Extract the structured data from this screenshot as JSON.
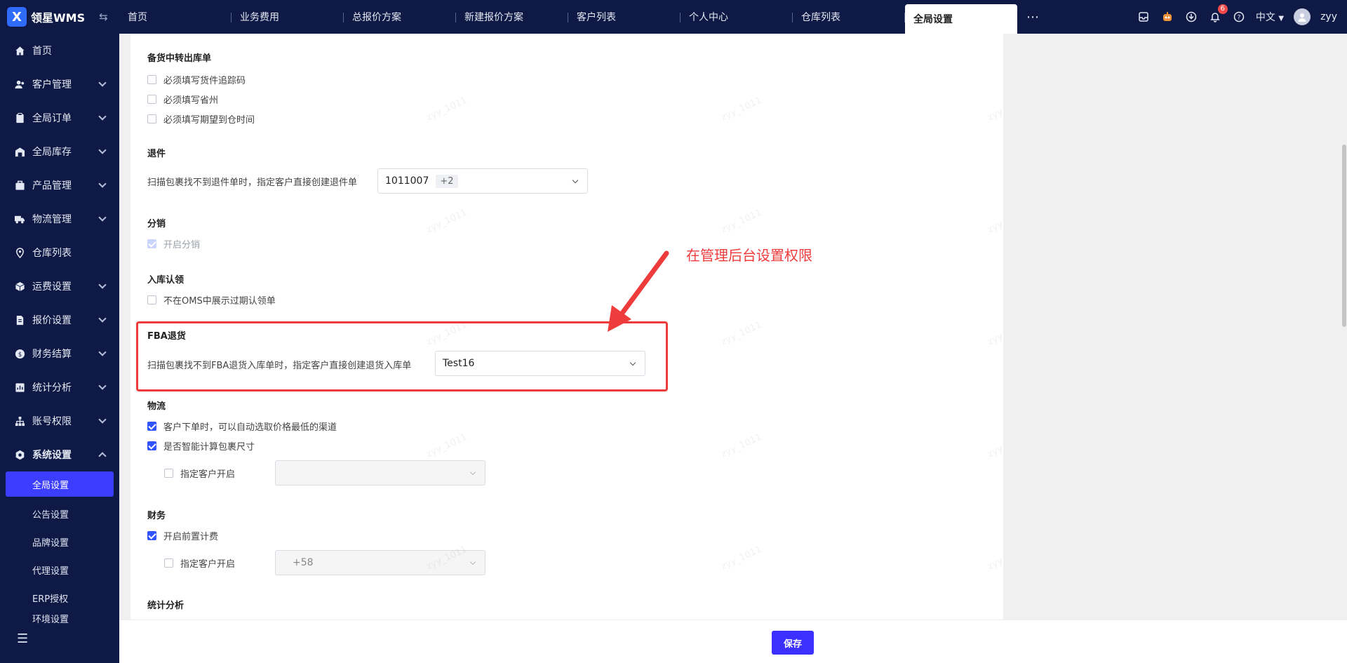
{
  "app": {
    "logo_letter": "X",
    "name": "领星WMS"
  },
  "tabs": [
    {
      "label": "首页"
    },
    {
      "label": "业务费用"
    },
    {
      "label": "总报价方案"
    },
    {
      "label": "新建报价方案"
    },
    {
      "label": "客户列表"
    },
    {
      "label": "个人中心"
    },
    {
      "label": "仓库列表"
    },
    {
      "label": "全局设置",
      "active": true
    }
  ],
  "header": {
    "notification_count": "6",
    "language": "中文",
    "username": "zyy"
  },
  "sidebar": {
    "items": [
      {
        "label": "首页",
        "icon": "home-icon"
      },
      {
        "label": "客户管理",
        "icon": "users-icon"
      },
      {
        "label": "全局订单",
        "icon": "clipboard-icon"
      },
      {
        "label": "全局库存",
        "icon": "warehouse-icon"
      },
      {
        "label": "产品管理",
        "icon": "box-icon"
      },
      {
        "label": "物流管理",
        "icon": "truck-icon"
      },
      {
        "label": "仓库列表",
        "icon": "location-icon"
      },
      {
        "label": "运费设置",
        "icon": "cube-icon"
      },
      {
        "label": "报价设置",
        "icon": "document-icon"
      },
      {
        "label": "财务结算",
        "icon": "coin-icon"
      },
      {
        "label": "统计分析",
        "icon": "chart-icon"
      },
      {
        "label": "账号权限",
        "icon": "org-icon"
      },
      {
        "label": "系统设置",
        "icon": "settings-icon"
      }
    ],
    "sub_items": [
      {
        "label": "全局设置"
      },
      {
        "label": "公告设置"
      },
      {
        "label": "品牌设置"
      },
      {
        "label": "代理设置"
      },
      {
        "label": "ERP授权"
      },
      {
        "label": "环境设置"
      }
    ]
  },
  "sections": {
    "stockup": {
      "title": "备货中转出库单",
      "options": [
        "必须填写货件追踪码",
        "必须填写省州",
        "必须填写期望到仓时间"
      ]
    },
    "returns": {
      "title": "退件",
      "label": "扫描包裹找不到退件单时，指定客户直接创建退件单",
      "select_value": "1011007",
      "select_extra": "+2"
    },
    "distribution": {
      "title": "分销",
      "option": "开启分销"
    },
    "inbound_claim": {
      "title": "入库认领",
      "option": "不在OMS中展示过期认领单"
    },
    "fba_return": {
      "title": "FBA退货",
      "label": "扫描包裹找不到FBA退货入库单时，指定客户直接创建退货入库单",
      "select_value": "Test16"
    },
    "logistics": {
      "title": "物流",
      "option1": "客户下单时，可以自动选取价格最低的渠道",
      "option2": "是否智能计算包裹尺寸",
      "sub_option": "指定客户开启"
    },
    "finance": {
      "title": "财务",
      "option": "开启前置计费",
      "sub_option": "指定客户开启",
      "select_value": "+58"
    },
    "stats": {
      "title": "统计分析"
    }
  },
  "annotation": {
    "text": "在管理后台设置权限",
    "color": "#ee3b3b"
  },
  "footer": {
    "save_label": "保存"
  },
  "watermark_text": "zyy_1011",
  "colors": {
    "sidebar_bg": "#0e1a45",
    "accent": "#3b30ff",
    "annotation": "#ee3b3b"
  }
}
